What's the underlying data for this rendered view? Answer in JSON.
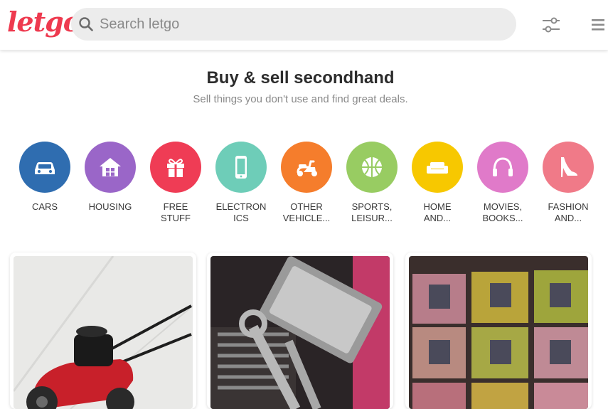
{
  "header": {
    "logo_text": "letgo",
    "logo_color": "#ee3a4f",
    "search_placeholder": "Search letgo",
    "filter_icon": "sliders-icon",
    "menu_icon": "hamburger-menu-icon"
  },
  "hero": {
    "title": "Buy & sell secondhand",
    "subtitle": "Sell things you don't use and find great deals."
  },
  "categories": [
    {
      "label": "CARS",
      "color": "#2f6db0",
      "icon": "car-icon"
    },
    {
      "label": "HOUSING",
      "color": "#9a66c8",
      "icon": "house-icon"
    },
    {
      "label": "FREE\nSTUFF",
      "color": "#ef3c55",
      "icon": "gift-icon"
    },
    {
      "label": "ELECTRON\nICS",
      "color": "#6ecdb8",
      "icon": "phone-icon"
    },
    {
      "label": "OTHER\nVEHICLE...",
      "color": "#f57d2c",
      "icon": "scooter-icon"
    },
    {
      "label": "SPORTS,\nLEISUR...",
      "color": "#98cc62",
      "icon": "basketball-icon"
    },
    {
      "label": "HOME\nAND...",
      "color": "#f7c800",
      "icon": "sofa-icon"
    },
    {
      "label": "MOVIES,\nBOOKS...",
      "color": "#e07ac9",
      "icon": "headphones-icon"
    },
    {
      "label": "FASHION\nAND...",
      "color": "#f07a88",
      "icon": "high-heel-icon"
    }
  ],
  "listings": [
    {
      "photo": "lawn-mower-photo"
    },
    {
      "photo": "tool-set-photo"
    },
    {
      "photo": "trading-cards-photo"
    }
  ]
}
